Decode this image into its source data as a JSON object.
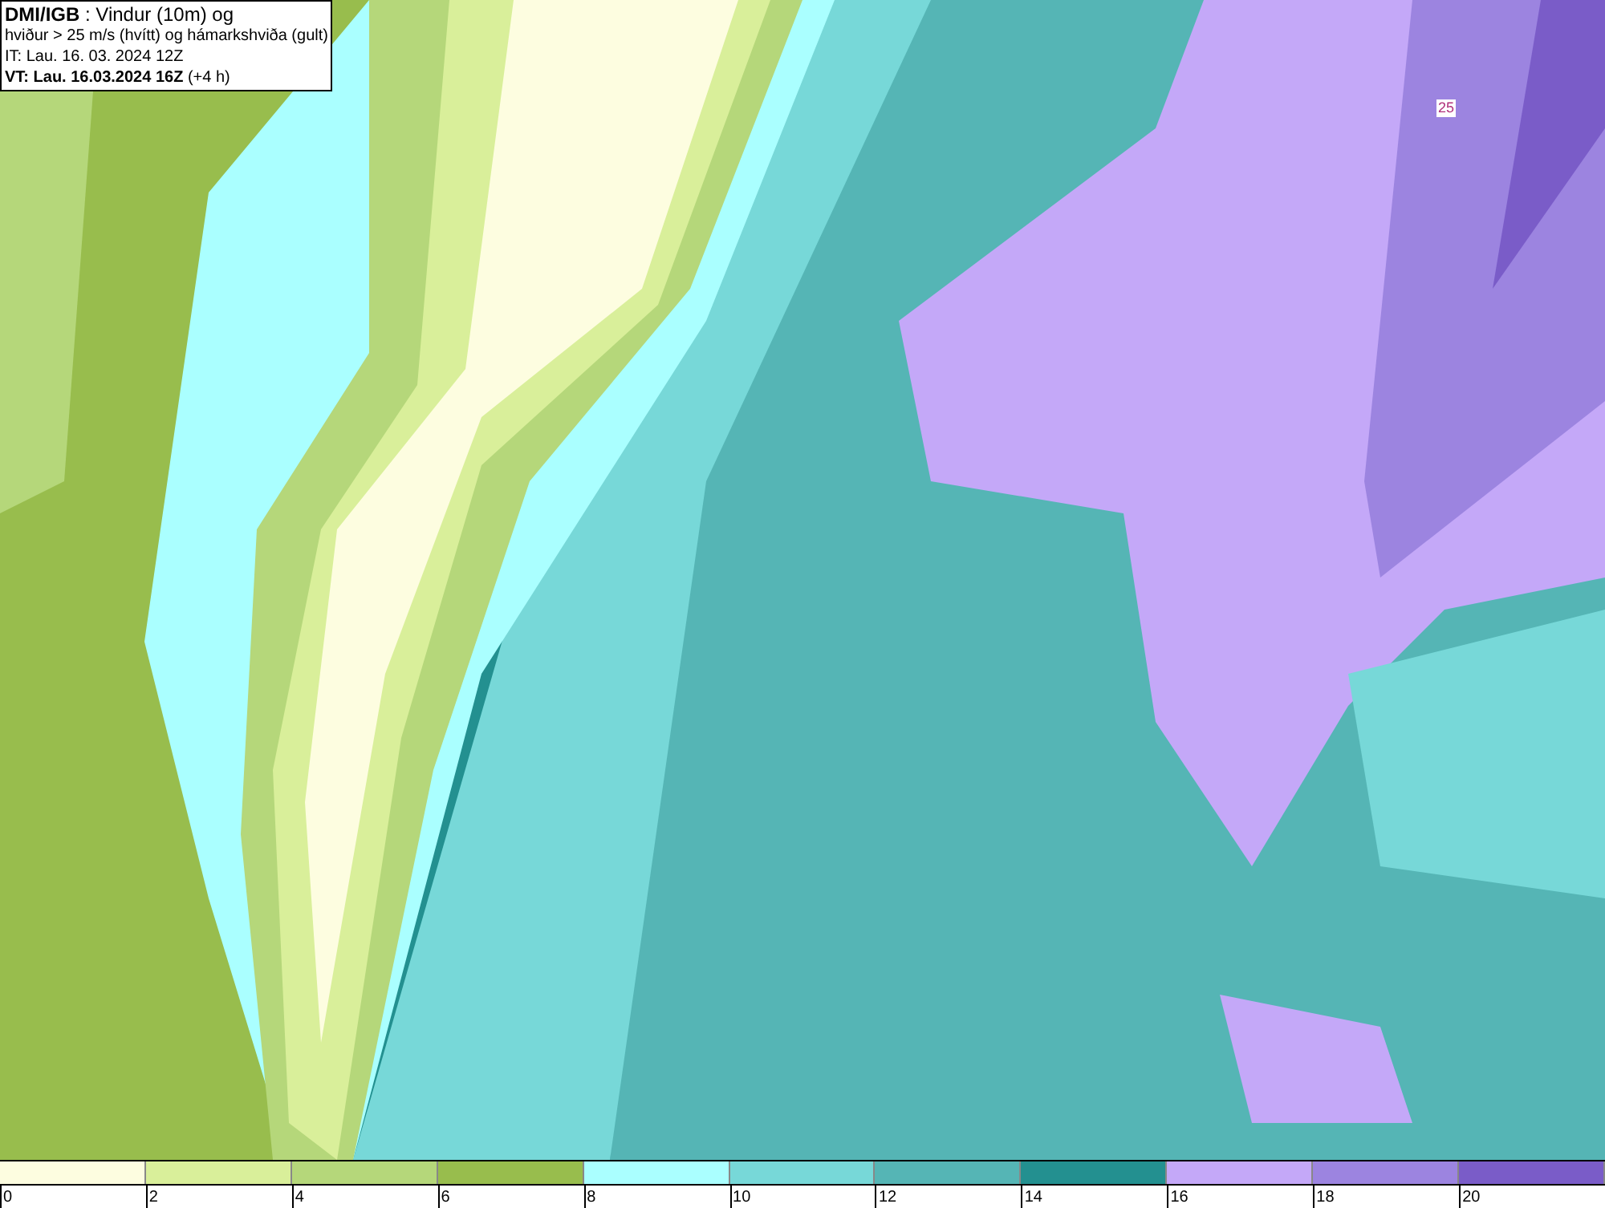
{
  "title_box": {
    "lines": [
      "**DMI/IGB** : Vindur (10m) og",
      "hviður > 25 m/s (hvítt) og hámarkshviða (gult)",
      "IT: Lau. 16. 03. 2024 12Z",
      "**VT: Lau. 16.03.2024 16Z** (+4 h)"
    ]
  },
  "map": {
    "contour_label": "25"
  },
  "legend": [
    {
      "label": "0",
      "color": "#fdfde0"
    },
    {
      "label": "2",
      "color": "#d9ef9a"
    },
    {
      "label": "4",
      "color": "#b5d77a"
    },
    {
      "label": "6",
      "color": "#98bd4d"
    },
    {
      "label": "8",
      "color": "#aaffff"
    },
    {
      "label": "10",
      "color": "#77d8d8"
    },
    {
      "label": "12",
      "color": "#55b5b5"
    },
    {
      "label": "14",
      "color": "#239090"
    },
    {
      "label": "16",
      "color": "#c4a8f8"
    },
    {
      "label": "18",
      "color": "#9c84e0"
    },
    {
      "label": "20",
      "color": "#7a5cc8"
    }
  ]
}
